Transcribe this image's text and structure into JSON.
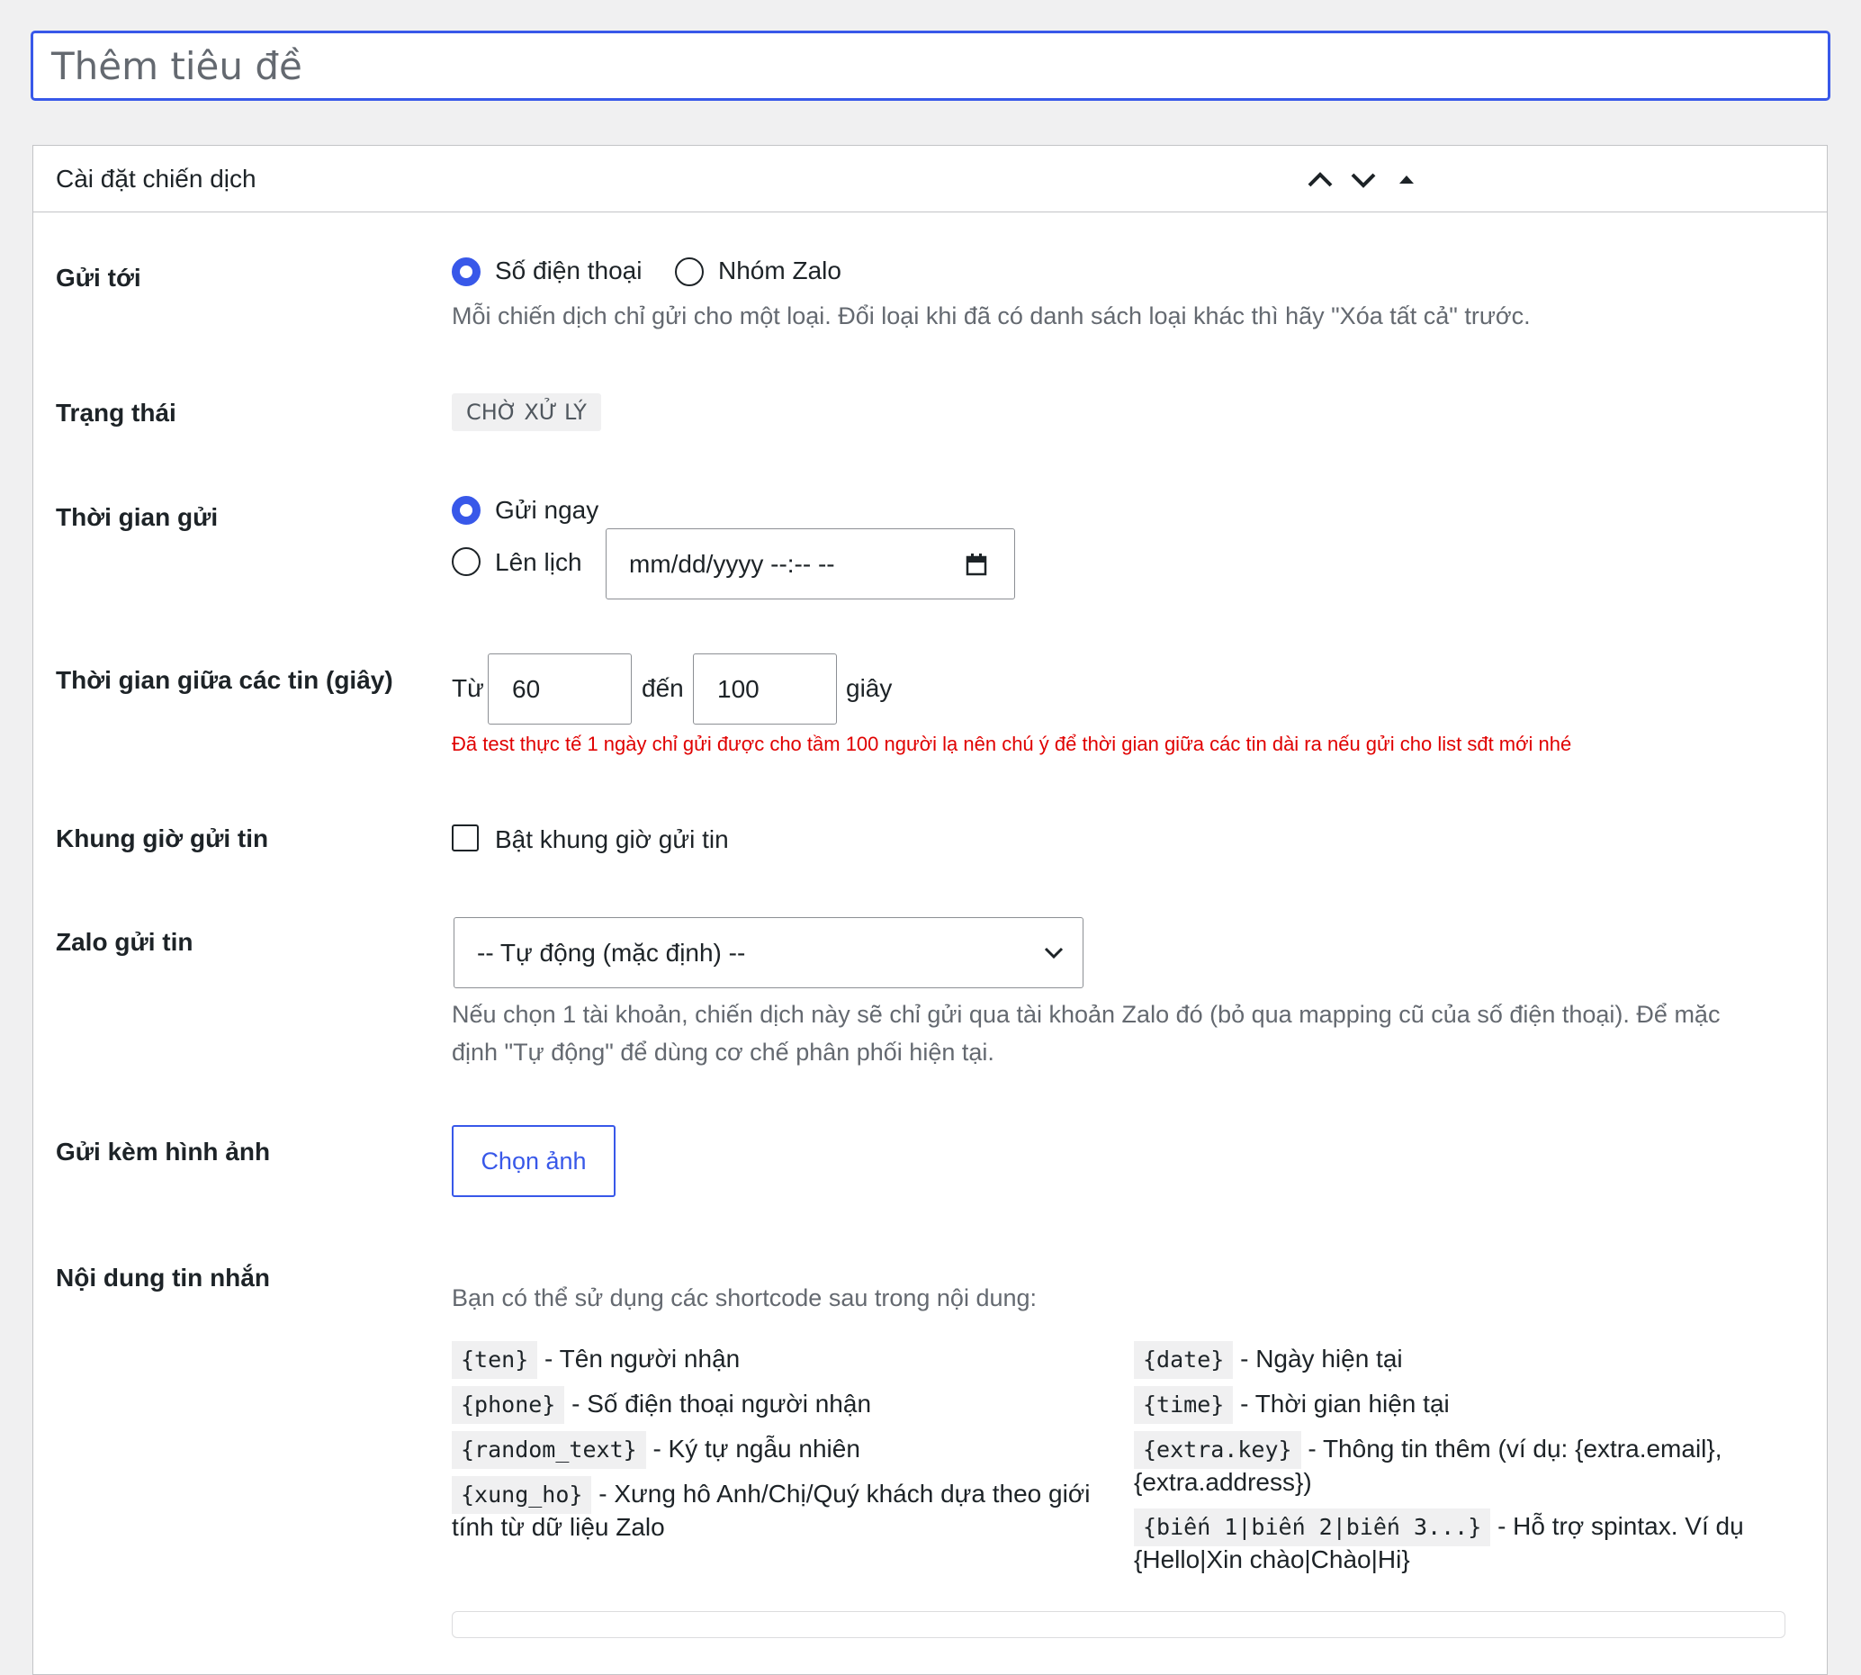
{
  "title_placeholder": "Thêm tiêu đề",
  "box": {
    "title": "Cài đặt chiến dịch",
    "icons": [
      "chevron-up-icon",
      "chevron-down-icon",
      "toggle-triangle-icon"
    ]
  },
  "send_to": {
    "label": "Gửi tới",
    "option_phone": "Số điện thoại",
    "option_group": "Nhóm Zalo",
    "selected": "Số điện thoại",
    "description": "Mỗi chiến dịch chỉ gửi cho một loại. Đổi loại khi đã có danh sách loại khác thì hãy \"Xóa tất cả\" trước."
  },
  "status": {
    "label": "Trạng thái",
    "value": "CHỜ XỬ LÝ"
  },
  "send_time": {
    "label": "Thời gian gửi",
    "option_now": "Gửi ngay",
    "option_schedule": "Lên lịch",
    "selected": "Gửi ngay",
    "datetime_placeholder": "mm/dd/yyyy --:-- --"
  },
  "interval": {
    "label": "Thời gian giữa các tin (giây)",
    "from_label": "Từ",
    "from_value": "60",
    "to_label": "đến",
    "to_value": "100",
    "unit": "giây",
    "warning": "Đã test thực tế 1 ngày chỉ gửi được cho tầm 100 người lạ nên chú ý để thời gian giữa các tin dài ra nếu gửi cho list sđt mới nhé"
  },
  "time_window": {
    "label": "Khung giờ gửi tin",
    "checkbox_label": "Bật khung giờ gửi tin",
    "checked": false
  },
  "zalo_sender": {
    "label": "Zalo gửi tin",
    "selected": "-- Tự động (mặc định) --",
    "desc_line1": "Nếu chọn 1 tài khoản, chiến dịch này sẽ chỉ gửi qua tài khoản Zalo đó (bỏ qua mapping cũ của số điện thoại). Để mặc",
    "desc_line2": "định \"Tự động\" để dùng cơ chế phân phối hiện tại."
  },
  "image": {
    "label": "Gửi kèm hình ảnh",
    "button": "Chọn ảnh"
  },
  "message": {
    "label": "Nội dung tin nhắn",
    "intro": "Bạn có thể sử dụng các shortcode sau trong nội dung:",
    "sc_ten_code": "{ten}",
    "sc_ten_desc": " - Tên người nhận",
    "sc_phone_code": "{phone}",
    "sc_phone_desc": " - Số điện thoại người nhận",
    "sc_random_code": "{random_text}",
    "sc_random_desc": " - Ký tự ngẫu nhiên",
    "sc_xungho_code": "{xung_ho}",
    "sc_xungho_desc_1": " - Xưng hô Anh/Chị/Quý khách dựa theo giới",
    "sc_xungho_desc_2": "tính từ dữ liệu Zalo",
    "sc_date_code": "{date}",
    "sc_date_desc": " - Ngày hiện tại",
    "sc_time_code": "{time}",
    "sc_time_desc": " - Thời gian hiện tại",
    "sc_extra_code": "{extra.key}",
    "sc_extra_desc_1": " - Thông tin thêm (ví dụ: {extra.email},",
    "sc_extra_desc_2": "{extra.address})",
    "sc_spin_code": "{biến 1|biến 2|biến 3...}",
    "sc_spin_desc_1": " - Hỗ trợ spintax. Ví dụ",
    "sc_spin_desc_2": "{Hello|Xin chào|Chào|Hi}"
  }
}
